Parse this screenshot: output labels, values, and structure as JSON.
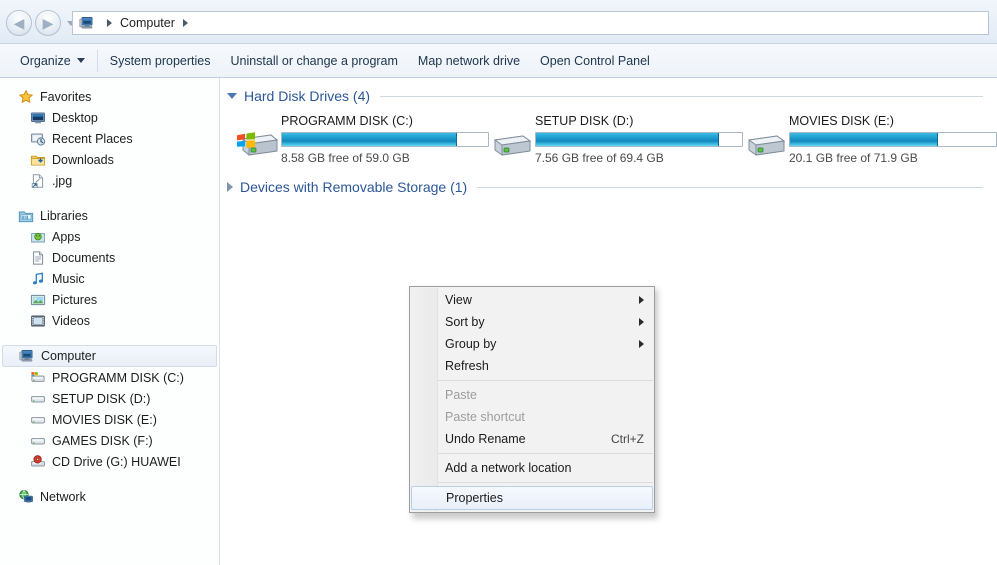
{
  "window": {
    "title": "Computer"
  },
  "addressbar": {
    "back_icon": "back-arrow-icon",
    "forward_icon": "forward-arrow-icon",
    "history_icon": "history-dropdown-icon",
    "computer_icon": "computer-icon",
    "crumb": "Computer",
    "trailing_separator": "▸"
  },
  "toolbar": {
    "items": [
      {
        "label": "Organize",
        "has_caret": true
      },
      {
        "label": "System properties",
        "has_caret": false
      },
      {
        "label": "Uninstall or change a program",
        "has_caret": false
      },
      {
        "label": "Map network drive",
        "has_caret": false
      },
      {
        "label": "Open Control Panel",
        "has_caret": false
      }
    ]
  },
  "sidebar": {
    "groups": [
      {
        "header": {
          "label": "Favorites",
          "icon": "star-icon"
        },
        "items": [
          {
            "label": "Desktop",
            "icon": "desktop-icon"
          },
          {
            "label": "Recent Places",
            "icon": "recent-places-icon"
          },
          {
            "label": "Downloads",
            "icon": "downloads-folder-icon"
          },
          {
            "label": ".jpg",
            "icon": "shortcut-file-icon"
          }
        ]
      },
      {
        "header": {
          "label": "Libraries",
          "icon": "libraries-icon"
        },
        "items": [
          {
            "label": "Apps",
            "icon": "apps-library-icon"
          },
          {
            "label": "Documents",
            "icon": "documents-library-icon"
          },
          {
            "label": "Music",
            "icon": "music-library-icon"
          },
          {
            "label": "Pictures",
            "icon": "pictures-library-icon"
          },
          {
            "label": "Videos",
            "icon": "videos-library-icon"
          }
        ]
      },
      {
        "header": {
          "label": "Computer",
          "icon": "computer-icon",
          "selected": true
        },
        "items": [
          {
            "label": "PROGRAMM DISK (C:)",
            "icon": "windows-drive-icon"
          },
          {
            "label": "SETUP DISK (D:)",
            "icon": "drive-icon"
          },
          {
            "label": "MOVIES DISK (E:)",
            "icon": "drive-icon"
          },
          {
            "label": "GAMES DISK (F:)",
            "icon": "drive-icon"
          },
          {
            "label": "CD Drive (G:) HUAWEI",
            "icon": "cd-drive-icon"
          }
        ]
      },
      {
        "header": {
          "label": "Network",
          "icon": "network-icon"
        },
        "items": []
      }
    ]
  },
  "content": {
    "groups": [
      {
        "title": "Hard Disk Drives (4)",
        "expanded": true,
        "drives": [
          {
            "name": "PROGRAMM DISK (C:)",
            "free": "8.58 GB free of 59.0 GB",
            "used_percent": 85,
            "icon": "windows-drive-icon"
          },
          {
            "name": "SETUP DISK (D:)",
            "free": "7.56 GB free of 69.4 GB",
            "used_percent": 89,
            "icon": "drive-icon"
          },
          {
            "name": "MOVIES DISK (E:)",
            "free": "20.1 GB free of 71.9 GB",
            "used_percent": 72,
            "icon": "drive-icon"
          }
        ]
      },
      {
        "title": "Devices with Removable Storage (1)",
        "expanded": false,
        "drives": []
      }
    ]
  },
  "context_menu": {
    "items": [
      {
        "label": "View",
        "type": "submenu",
        "disabled": false,
        "accel": "",
        "highlighted": false
      },
      {
        "label": "Sort by",
        "type": "submenu",
        "disabled": false,
        "accel": "",
        "highlighted": false
      },
      {
        "label": "Group by",
        "type": "submenu",
        "disabled": false,
        "accel": "",
        "highlighted": false
      },
      {
        "label": "Refresh",
        "type": "item",
        "disabled": false,
        "accel": "",
        "highlighted": false
      },
      {
        "type": "separator"
      },
      {
        "label": "Paste",
        "type": "item",
        "disabled": true,
        "accel": "",
        "highlighted": false
      },
      {
        "label": "Paste shortcut",
        "type": "item",
        "disabled": true,
        "accel": "",
        "highlighted": false
      },
      {
        "label": "Undo Rename",
        "type": "item",
        "disabled": false,
        "accel": "Ctrl+Z",
        "highlighted": false
      },
      {
        "type": "separator"
      },
      {
        "label": "Add a network location",
        "type": "item",
        "disabled": false,
        "accel": "",
        "highlighted": false
      },
      {
        "type": "separator"
      },
      {
        "label": "Properties",
        "type": "item",
        "disabled": false,
        "accel": "",
        "highlighted": true
      }
    ]
  },
  "colors": {
    "accent_heading": "#2b5797",
    "bar_fill": "#1b93c6",
    "chrome": "#e9f0f8"
  }
}
